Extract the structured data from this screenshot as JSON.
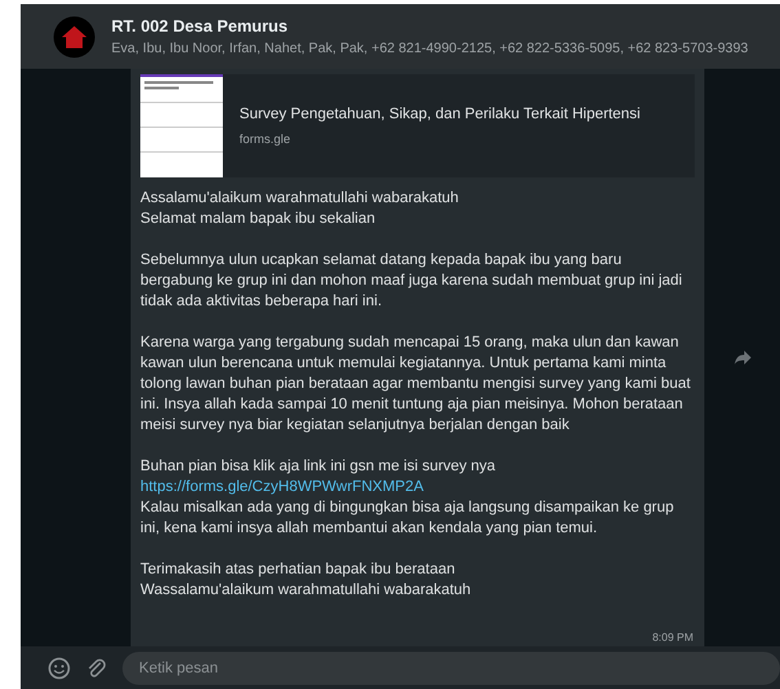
{
  "chat_header": {
    "title": "RT. 002 Desa Pemurus",
    "members": "Eva, Ibu, Ibu Noor, Irfan, Nahet, Pak, Pak, +62 821-4990-2125, +62 822-5336-5095, +62 823-5703-9393"
  },
  "message": {
    "preview": {
      "title": "Survey Pengetahuan, Sikap, dan Perilaku Terkait Hipertensi",
      "domain": "forms.gle"
    },
    "paragraphs": [
      {
        "kind": "text",
        "lines": [
          "Assalamu'alaikum warahmatullahi wabarakatuh",
          "Selamat malam bapak ibu sekalian"
        ]
      },
      {
        "kind": "text",
        "lines": [
          "Sebelumnya ulun ucapkan selamat datang kepada bapak ibu yang baru bergabung ke grup ini dan mohon maaf juga karena sudah membuat grup ini jadi tidak ada aktivitas beberapa hari ini."
        ]
      },
      {
        "kind": "text",
        "lines": [
          "Karena warga yang tergabung sudah mencapai 15 orang, maka ulun dan kawan kawan ulun berencana untuk memulai kegiatannya. Untuk pertama kami minta tolong lawan buhan pian berataan agar membantu mengisi survey yang kami buat ini. Insya allah kada sampai 10 menit tuntung aja pian meisinya. Mohon berataan meisi survey nya biar kegiatan selanjutnya berjalan dengan baik"
        ]
      },
      {
        "kind": "link",
        "lines": [
          "Buhan pian bisa klik aja link ini gsn me isi survey nya",
          "https://forms.gle/CzyH8WPWwrFNXMP2A",
          "Kalau misalkan ada yang di bingungkan bisa aja langsung disampaikan ke grup ini, kena kami insya allah membantui akan kendala yang pian temui."
        ]
      },
      {
        "kind": "text",
        "lines": [
          "Terimakasih atas perhatian bapak ibu berataan",
          "Wassalamu'alaikum warahmatullahi wabarakatuh"
        ]
      }
    ],
    "time": "8:09 PM"
  },
  "composer": {
    "placeholder": "Ketik pesan"
  }
}
